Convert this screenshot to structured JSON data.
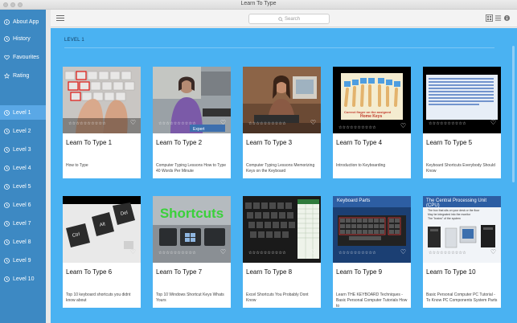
{
  "window": {
    "title": "Learn To Type"
  },
  "sidebar": {
    "items": [
      {
        "label": "About App",
        "icon": "info-icon"
      },
      {
        "label": "History",
        "icon": "clock-icon"
      },
      {
        "label": "Favourites",
        "icon": "heart-icon"
      },
      {
        "label": "Rating",
        "icon": "star-icon"
      },
      {
        "label": "Level 1",
        "icon": "clock-icon",
        "active": true
      },
      {
        "label": "Level 2",
        "icon": "clock-icon"
      },
      {
        "label": "Level 3",
        "icon": "clock-icon"
      },
      {
        "label": "Level 4",
        "icon": "clock-icon"
      },
      {
        "label": "Level 5",
        "icon": "clock-icon"
      },
      {
        "label": "Level 6",
        "icon": "clock-icon"
      },
      {
        "label": "Level 7",
        "icon": "clock-icon"
      },
      {
        "label": "Level 8",
        "icon": "clock-icon"
      },
      {
        "label": "Level 9",
        "icon": "clock-icon"
      },
      {
        "label": "Level 10",
        "icon": "clock-icon"
      }
    ]
  },
  "toolbar": {
    "search_placeholder": "Search"
  },
  "main": {
    "section_label": "LEVEL 1",
    "cards": [
      {
        "title": "Learn To Type 1",
        "desc": "How to Type",
        "rating_stars": "☆☆☆☆☆☆☆☆☆☆",
        "thumb": "keyboard-hands"
      },
      {
        "title": "Learn To Type 2",
        "desc": "Computer Typing Lessons  How to Type 40 Words Per Minute",
        "rating_stars": "☆☆☆☆☆☆☆☆☆☆",
        "thumb": "woman-desk"
      },
      {
        "title": "Learn To Type 3",
        "desc": "Computer Typing Lessons  Memorizing Keys on the Keyboard",
        "rating_stars": "☆☆☆☆☆☆☆☆☆☆",
        "thumb": "woman-computer"
      },
      {
        "title": "Learn To Type 4",
        "desc": "Introduction to Keyboarding",
        "rating_stars": "☆☆☆☆☆☆☆☆☆☆",
        "thumb": "home-keys",
        "thumb_caption_1": "Correct finger on the assigned",
        "thumb_caption_2": "Home Keys"
      },
      {
        "title": "Learn To Type 5",
        "desc": "Keyboard Shortcuts Everybody Should Know",
        "rating_stars": "☆☆☆☆☆☆☆☆☆☆",
        "thumb": "typing-text"
      },
      {
        "title": "Learn To Type 6",
        "desc": "Top 10 keyboard shortcuts you didnt know about",
        "rating_stars": "☆☆☆☆☆☆☆☆☆☆",
        "thumb": "ctrl-alt-del",
        "keys": [
          "Ctrl",
          "Alt",
          "Del"
        ]
      },
      {
        "title": "Learn To Type 7",
        "desc": "Top 10 Windows Shortcut Keys Whats Yours",
        "rating_stars": "☆☆☆☆☆☆☆☆☆☆",
        "thumb": "shortcuts",
        "thumb_caption_1": "Shortcuts"
      },
      {
        "title": "Learn To Type 8",
        "desc": "Excel Shortcuts You Probably Dont Know",
        "rating_stars": "☆☆☆☆☆☆☆☆☆☆",
        "thumb": "keyboard-excel"
      },
      {
        "title": "Learn To Type 9",
        "desc": "Learn THE KEYBOARD Techniques - Basic Personal Computer Tutorials How to",
        "rating_stars": "☆☆☆☆☆☆☆☆☆☆",
        "thumb": "keyboard-parts",
        "thumb_caption_1": "Keyboard Parts"
      },
      {
        "title": "Learn To Type 10",
        "desc": "Basic Personal Computer PC Tutorial - To Know PC Components System Parts",
        "rating_stars": "☆☆☆☆☆☆☆☆☆☆",
        "thumb": "cpu",
        "thumb_caption_1": "The Central Processing Unit (CPU)",
        "thumb_caption_2": "The box that sits on your desk or the floor",
        "thumb_caption_3": "May be integrated into the monitor",
        "thumb_caption_4": "The \"brains\" of the system"
      }
    ]
  },
  "colors": {
    "sidebar": "#3d89c3",
    "sidebar_active": "#5aa8e6",
    "content": "#4ab2f2"
  }
}
